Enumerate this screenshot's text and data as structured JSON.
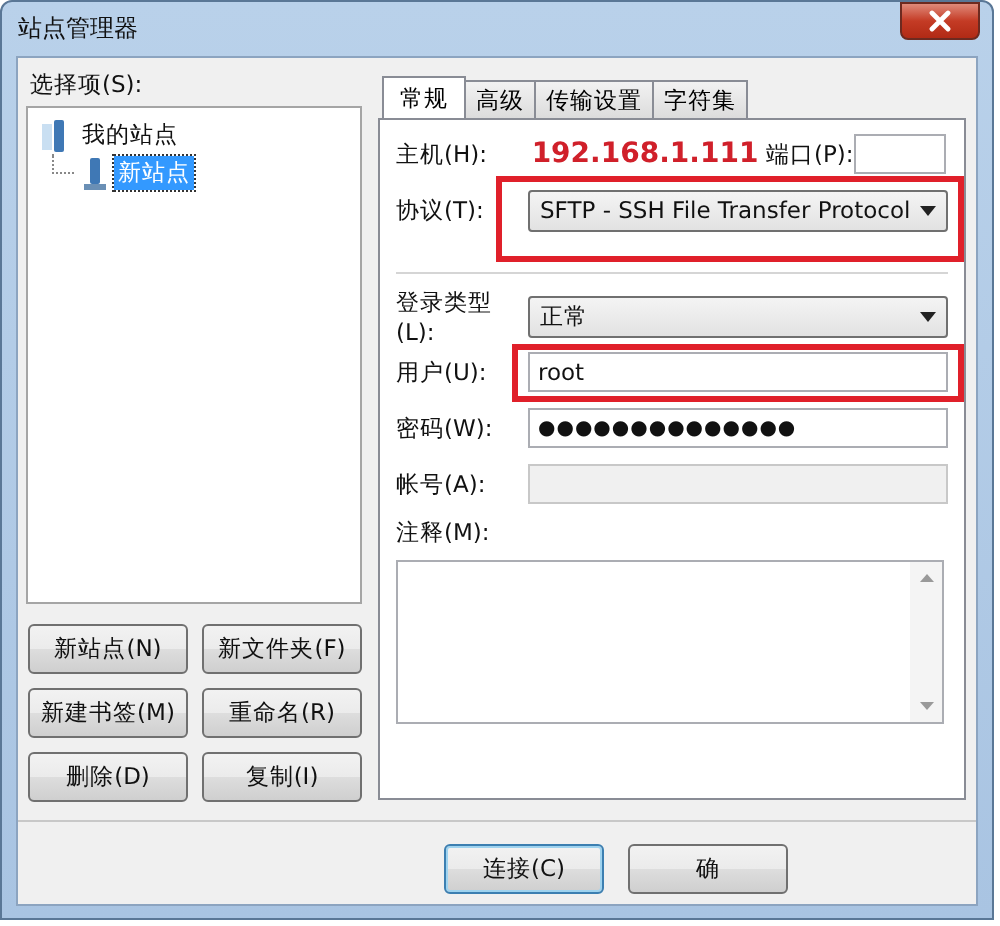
{
  "window": {
    "title": "站点管理器"
  },
  "select_panel": {
    "label": "选择项(S):",
    "tree": [
      {
        "label": "我的站点",
        "selected": false,
        "children": [
          {
            "label": "新站点",
            "selected": true
          }
        ]
      }
    ]
  },
  "buttons": [
    {
      "label": "新站点(N)"
    },
    {
      "label": "新文件夹(F)"
    },
    {
      "label": "新建书签(M)"
    },
    {
      "label": "重命名(R)"
    },
    {
      "label": "删除(D)"
    },
    {
      "label": "复制(I)"
    }
  ],
  "tabs": [
    {
      "label": "常规",
      "selected": true
    },
    {
      "label": "高级",
      "selected": false
    },
    {
      "label": "传输设置",
      "selected": false
    },
    {
      "label": "字符集",
      "selected": false
    }
  ],
  "general": {
    "host": {
      "label": "主机(H):",
      "value": "192.168.1.111"
    },
    "port": {
      "label": "端口(P):"
    },
    "protocol": {
      "label": "协议(T):",
      "value": "SFTP - SSH File Transfer Protocol",
      "highlighted": true
    },
    "logon_type": {
      "label": "登录类型(L):",
      "value": "正常"
    },
    "user": {
      "label": "用户(U):",
      "value": "root",
      "highlighted": true
    },
    "password": {
      "label": "密码(W):",
      "value": "●●●●●●●●●●●●●●"
    },
    "account": {
      "label": "帐号(A):",
      "disabled": true
    },
    "comments": {
      "label": "注释(M):"
    }
  },
  "footer_buttons": [
    {
      "label": "连接(C)",
      "default": true
    },
    {
      "label": "确",
      "default": false
    }
  ]
}
